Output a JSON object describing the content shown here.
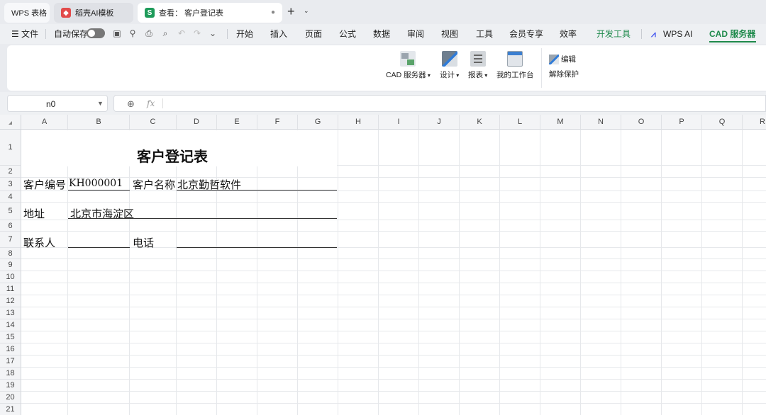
{
  "tabs": {
    "home": "WPS 表格",
    "ai_template": "稻壳AI模板",
    "active": "查看：  客户登记表",
    "close_glyph": "●",
    "new_tab": "+",
    "new_tab_menu": "⌄"
  },
  "menu": {
    "file": "文件",
    "autosave": "自动保存",
    "items": [
      "开始",
      "插入",
      "页面",
      "公式",
      "数据",
      "审阅",
      "视图",
      "工具",
      "会员专享",
      "效率"
    ],
    "dev_tools": "开发工具",
    "wps_ai": "WPS AI",
    "cad": "CAD 服务器"
  },
  "ribbon": {
    "cad_server": "CAD 服务器",
    "design": "设计",
    "report": "报表",
    "workbench": "我的工作台",
    "edit": "编辑",
    "unprotect": "解除保护"
  },
  "formula_bar": {
    "cell_ref": "n0",
    "fx": "fx",
    "content": ""
  },
  "columns": [
    "A",
    "B",
    "C",
    "D",
    "E",
    "F",
    "G",
    "H",
    "I",
    "J",
    "K",
    "L",
    "M",
    "N",
    "O",
    "P",
    "Q",
    "R"
  ],
  "rows": [
    "1",
    "2",
    "3",
    "4",
    "5",
    "6",
    "7",
    "8",
    "9",
    "10",
    "11",
    "12",
    "13",
    "14",
    "15",
    "16",
    "17",
    "18",
    "19",
    "20",
    "21"
  ],
  "sheet": {
    "title": "客户登记表",
    "customer_no_label": "客户编号",
    "customer_no_value": "KH000001",
    "customer_name_label": "客户名称",
    "customer_name_value": "北京勤哲软件",
    "address_label": "地址",
    "address_value": "北京市海淀区",
    "contact_label": "联系人",
    "phone_label": "电话"
  },
  "colors": {
    "accent_green": "#1f8a4c",
    "ai_tab_red": "#e24b4b",
    "sheet_tab_green": "#1e9b5a"
  }
}
